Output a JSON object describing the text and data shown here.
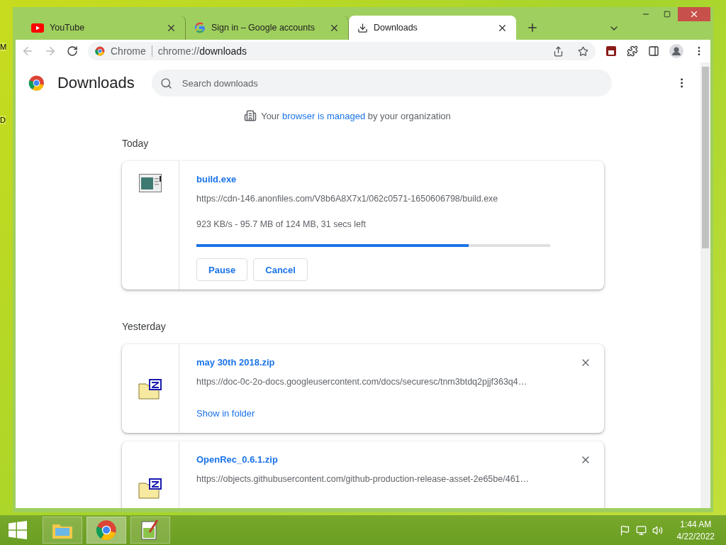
{
  "desktop_labels": [
    "M",
    "D"
  ],
  "tabs": [
    {
      "title": "YouTube",
      "kind": "youtube",
      "selected": false
    },
    {
      "title": "Sign in – Google accounts",
      "kind": "google",
      "selected": false
    },
    {
      "title": "Downloads",
      "kind": "download",
      "selected": true
    }
  ],
  "address_bar": {
    "site_label": "Chrome",
    "url_scheme": "chrome://",
    "url_rest": "downloads"
  },
  "page": {
    "title": "Downloads",
    "search": {
      "placeholder": "Search downloads"
    },
    "managed_notice": {
      "before": "Your",
      "link": "browser is managed",
      "after": "by your organization"
    },
    "sections": [
      {
        "heading": "Today",
        "items": [
          {
            "kind": "active",
            "name": "build.exe",
            "url": "https://cdn-146.anonfiles.com/V8b6A8X7x1/062c0571-1650606798/build.exe",
            "status": "923 KB/s - 95.7 MB of 124 MB, 31 secs left",
            "level": 0.77,
            "buttons": [
              "Pause",
              "Cancel"
            ]
          }
        ]
      },
      {
        "heading": "Yesterday",
        "items": [
          {
            "kind": "done",
            "name": "may 30th 2018.zip",
            "url": "https://doc-0c-2o-docs.googleusercontent.com/docs/securesc/tnm3btdq2pjjf363q4…",
            "link": "Show in folder"
          },
          {
            "kind": "done",
            "name": "OpenRec_0.6.1.zip",
            "url": "https://objects.githubusercontent.com/github-production-release-asset-2e65be/461…"
          }
        ]
      }
    ]
  },
  "taskbar": {
    "apps": [
      {
        "kind": "explorer",
        "selected": false
      },
      {
        "kind": "chrome",
        "selected": true
      },
      {
        "kind": "notepad",
        "selected": false
      }
    ],
    "time": "1:44 AM",
    "date": "4/22/2022"
  }
}
